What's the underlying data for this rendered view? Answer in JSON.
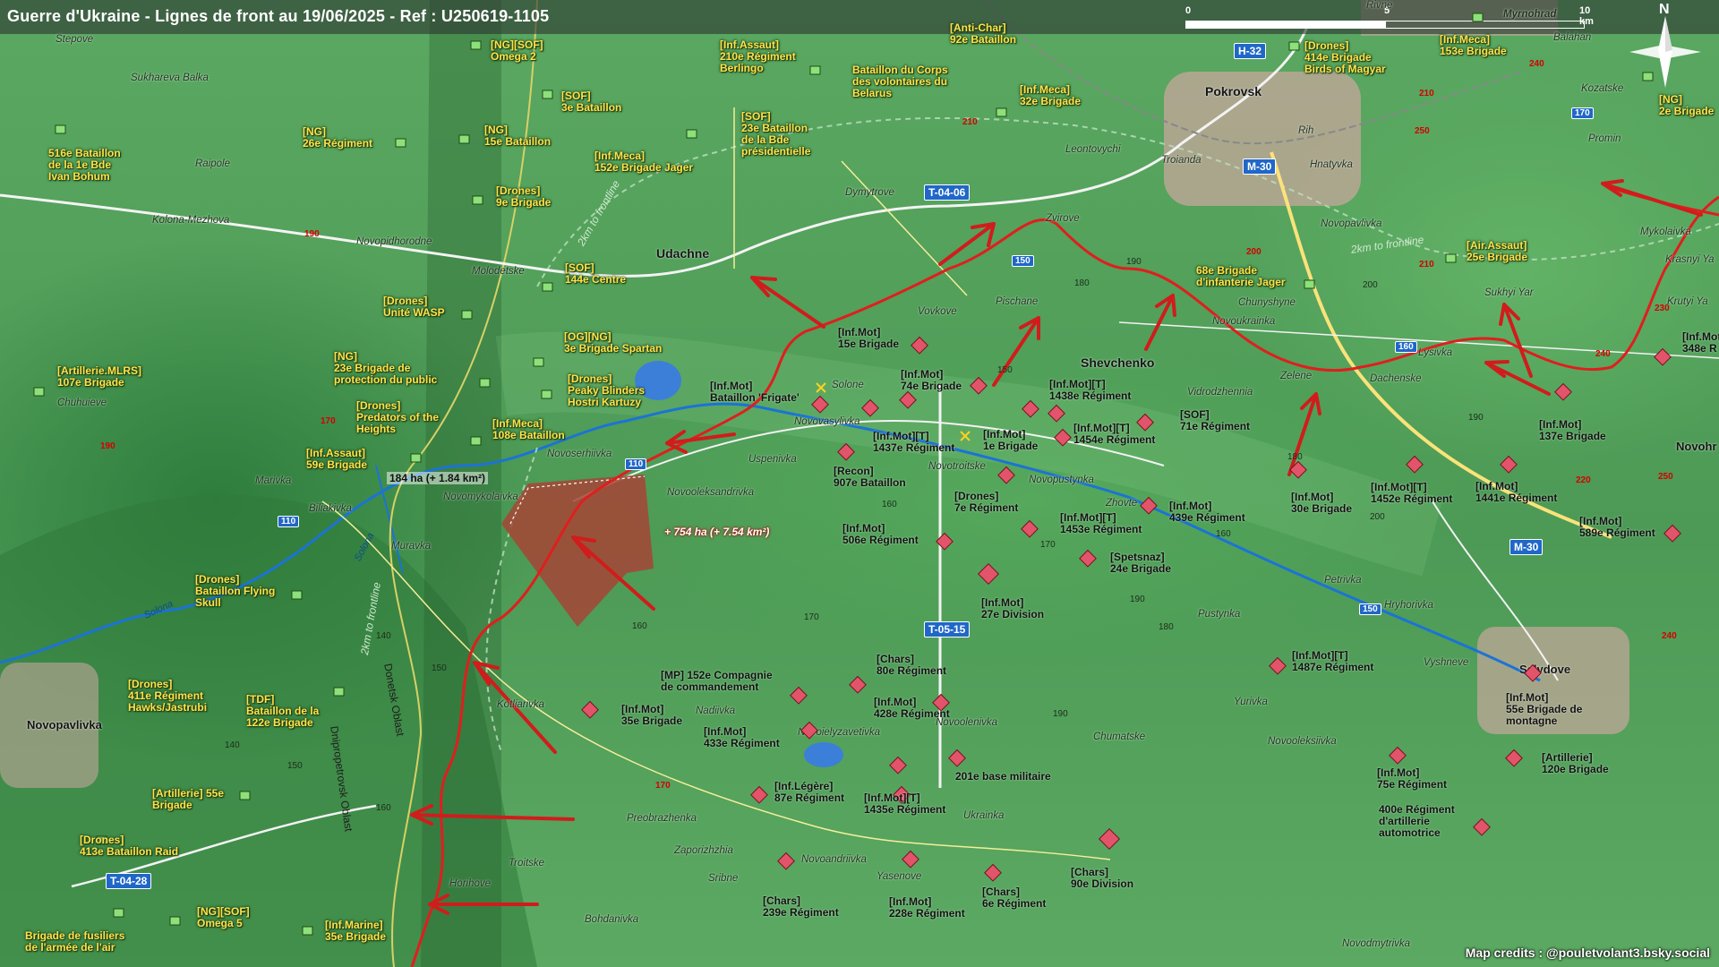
{
  "header": {
    "title": "Guerre d'Ukraine - Lignes de front au 19/06/2025 - Ref : U250619-1105",
    "scale_ticks": [
      "0",
      "5",
      "10 km"
    ],
    "north": "N"
  },
  "credits": "Map credits : @pouletvolant3.bsky.social",
  "colors": {
    "front_line": "#e01e1e",
    "ua_label": "#ffe34a",
    "ru_symbol": "#e2546a",
    "road_badge": "#2067c8",
    "loss_area": "#a64536"
  },
  "gain": {
    "text": "+ 754 ha (+ 7.54 km²)",
    "area_ha": 754
  },
  "area_small": {
    "text": "184 ha (+ 1.84 km²)",
    "area_ha": 184
  },
  "oblasts": {
    "dnipro": "Dnipropetrovsk Oblast",
    "donetsk": "Donetsk Oblast"
  },
  "frontline_labels": {
    "a": "2km to frontline",
    "b": "2km to frontline",
    "c": "2km to frontline"
  },
  "rivers": {
    "solona1": "Solona",
    "solona2": "Solona"
  },
  "roads": {
    "h32": "H-32",
    "m30a": "M-30",
    "m30b": "M-30",
    "t0406": "T-04-06",
    "t0515": "T-05-15",
    "t0428": "T-04-28",
    "r110a": "110",
    "r110b": "110",
    "r150a": "150",
    "r150b": "150",
    "r160": "160",
    "r170": "170"
  },
  "route_numbers": {
    "a": "190",
    "b": "170",
    "c": "190",
    "d": "210",
    "e": "210",
    "f": "250",
    "g": "240",
    "h": "200",
    "i": "210",
    "j": "230",
    "k": "220",
    "l": "250",
    "m": "240",
    "n": "170",
    "o": "240"
  },
  "elevations": {
    "a": "190",
    "b": "180",
    "c": "200",
    "d": "150",
    "e": "160",
    "f": "170",
    "g": "180",
    "h": "170",
    "i": "190",
    "j": "180",
    "k": "190",
    "l": "160",
    "m": "160",
    "n": "150",
    "o": "140",
    "p": "150",
    "q": "140",
    "r": "160",
    "s": "190",
    "t": "200"
  },
  "towns": {
    "stepove": "Stepove",
    "sukhareva": "Sukhareva Balka",
    "raipole": "Raipole",
    "kolona": "Kolona-Mezhova",
    "novopidh": "Novopidhorodne",
    "molodetske": "Molodetske",
    "udachne": "Udachne",
    "dymytrove": "Dymytrove",
    "pokrovsk": "Pokrovsk",
    "leontovychi": "Leontovychi",
    "troiandа": "Troianda",
    "rih": "Rih",
    "hnatyvka": "Hnatyvka",
    "zvirove": "Zvirove",
    "novopavlivka_n": "Novopavlivka",
    "myrnohrad": "Myrnohrad",
    "rivne": "Rivne",
    "balahan": "Balahan",
    "kozatske": "Kozatske",
    "promin": "Promin",
    "mykolaivka": "Mykolaivka",
    "krasnyi": "Krasnyi Ya",
    "krutyi": "Krutyi Ya",
    "sukhyi": "Sukhyi Yar",
    "lysivka": "Lysivka",
    "chunyshyne": "Chunyshyne",
    "novoukrainka": "Novoukrainka",
    "pischane": "Pischane",
    "vovkove": "Vovkove",
    "shevchenko": "Shevchenko",
    "vidrodzhennia": "Vidrodzhennia",
    "zelene": "Zelene",
    "dachenske": "Dachenske",
    "novohr": "Novohr",
    "solone": "Solone",
    "novovasylivka": "Novovasylivka",
    "uspenivka": "Uspenivka",
    "novoserhiivka": "Novoserhiivka",
    "novomykolaivka": "Novomykolaivka",
    "novooleksandrivka": "Novooleksandrivka",
    "novotroitske": "Novotroitske",
    "novopustynka": "Novopustynka",
    "zhovte": "Zhovte",
    "marivka": "Marivka",
    "biliakivka": "Biliakivka",
    "muravka": "Muravka",
    "chuhuieve": "Chuhuieve",
    "novopavlivka": "Novopavlivka",
    "kotliarivka": "Kotliarivka",
    "nadiivka": "Nadiivka",
    "novoielyzavetivka": "Novoielyzavetivka",
    "novoolenivka": "Novoolenivka",
    "chumatske": "Chumatske",
    "pustynka": "Pustynka",
    "yurivka": "Yurivka",
    "petrivka": "Petrivka",
    "hryhorivka": "Hryhorivka",
    "vyshneve": "Vyshneve",
    "selydove": "Selydove",
    "novooleksiivka": "Novooleksiivka",
    "preobrazhenka": "Preobrazhenka",
    "zaporizhzhia": "Zaporizhzhia",
    "sribne": "Sribne",
    "troitske": "Troitske",
    "horihove": "Horihove",
    "bohdanivka": "Bohdanivka",
    "novoandriivka": "Novoandriivka",
    "yasenove": "Yasenove",
    "ukrainka": "Ukrainka",
    "novodmytrivka": "Novodmytrivka"
  },
  "ua_units": {
    "u1": "[NG][SOF]\nOmega 2",
    "u2": "[SOF]\n3e Bataillon",
    "u3": "[NG]\n26e Régiment",
    "u4": "[NG]\n15e Bataillon",
    "u5": "516e Bataillon\nde la 1e Bde\nIvan Bohum",
    "u6": "[Drones]\n9e Brigade",
    "u7": "[SOF]\n144e Centre",
    "u8": "[Drones]\nUnité WASP",
    "u9": "[OG][NG]\n3e Brigade Spartan",
    "u10": "[NG]\n23e Brigade de\nprotection du public",
    "u11": "[Drones]\nPeaky Blinders\nHostri Kartuzy",
    "u12": "[Drones]\nPredators of the\nHeights",
    "u13": "[Inf.Meca]\n108e Bataillon",
    "u14": "[Inf.Assaut]\n59e Brigade",
    "u15": "[Artillerie.MLRS]\n107e Brigade",
    "u16": "[Inf.Assaut]\n210e Régiment\nBerlingo",
    "u17": "Bataillon du Corps\ndes volontaires du\nBelarus",
    "u18": "[SOF]\n23e Bataillon\nde la Bde\nprésidentielle",
    "u19": "[Inf.Meca]\n152e Brigade Jager",
    "u20": "[Anti-Char]\n92e Bataillon",
    "u21": "[Inf.Meca]\n32e Brigade",
    "u22": "[Drones]\n414e Brigade\nBirds of Magyar",
    "u23": "[Inf.Meca]\n153e Brigade",
    "u24": "[NG]\n2e Brigade",
    "u25": "[Air.Assaut]\n25e Brigade",
    "u26": "68e Brigade\nd'infanterie Jager",
    "u27": "[Drones]\nBataillon Flying\nSkull",
    "u28": "[Drones]\n411e Régiment\nHawks/Jastrubi",
    "u29": "[TDF]\nBataillon de la\n122e Brigade",
    "u30": "[Artillerie] 55e\nBrigade",
    "u31": "[Drones]\n413e Bataillon Raid",
    "u32": "[NG][SOF]\nOmega 5",
    "u33": "[Inf.Marine]\n35e Brigade",
    "u34": "Brigade de fusiliers\nde l'armée de l'air"
  },
  "ru_units": {
    "r1": "[Inf.Mot]\n15e Brigade",
    "r2": "[Inf.Mot]\nBataillon 'Frigate'",
    "r3": "[Inf.Mot]\n74e Brigade",
    "r4": "[Inf.Mot][T]\n1438e Régiment",
    "r5": "[Inf.Mot][T]\n1437e Régiment",
    "r6": "[Inf.Mot]\n1e Brigade",
    "r7": "[Inf.Mot][T]\n1454e Régiment",
    "r8": "[SOF]\n71e Régiment",
    "r9": "[Recon]\n907e Bataillon",
    "r10": "[Drones]\n7e Régiment",
    "r11": "[Inf.Mot]\n439e Régiment",
    "r12": "[Inf.Mot][T]\n1453e Régiment",
    "r13": "[Inf.Mot]\n506e Régiment",
    "r14": "[Spetsnaz]\n24e Brigade",
    "r15": "[Inf.Mot]\n27e Division",
    "r16": "[Inf.Mot]\n30e Brigade",
    "r17": "[Inf.Mot][T]\n1452e Régiment",
    "r18": "[Inf.Mot]\n1441e Régiment",
    "r19": "[Inf.Mot]\n589e Régiment",
    "r20": "[Inf.Mot]\n137e Brigade",
    "r21": "[Inf.Mot]\n348e R",
    "r22": "[Inf.Mot][T]\n1487e Régiment",
    "r23": "[Inf.Mot]\n55e Brigade de\nmontagne",
    "r24": "[Artillerie]\n120e Brigade",
    "r25": "[Inf.Mot]\n75e Régiment",
    "r26": "400e Régiment\nd'artillerie\nautomotrice",
    "r27": "[Chars]\n80e Régiment",
    "r28": "[MP] 152e Compagnie\nde commandement",
    "r29": "[Inf.Mot]\n35e Brigade",
    "r30": "[Inf.Mot]\n428e Régiment",
    "r31": "[Inf.Mot]\n433e Régiment",
    "r32": "201e base militaire",
    "r33": "[Inf.Légère]\n87e Régiment",
    "r34": "[Inf.Mot][T]\n1435e Régiment",
    "r35": "[Chars]\n90e Division",
    "r36": "[Chars]\n239e Régiment",
    "r37": "[Inf.Mot]\n228e Régiment",
    "r38": "[Chars]\n6e Régiment"
  }
}
